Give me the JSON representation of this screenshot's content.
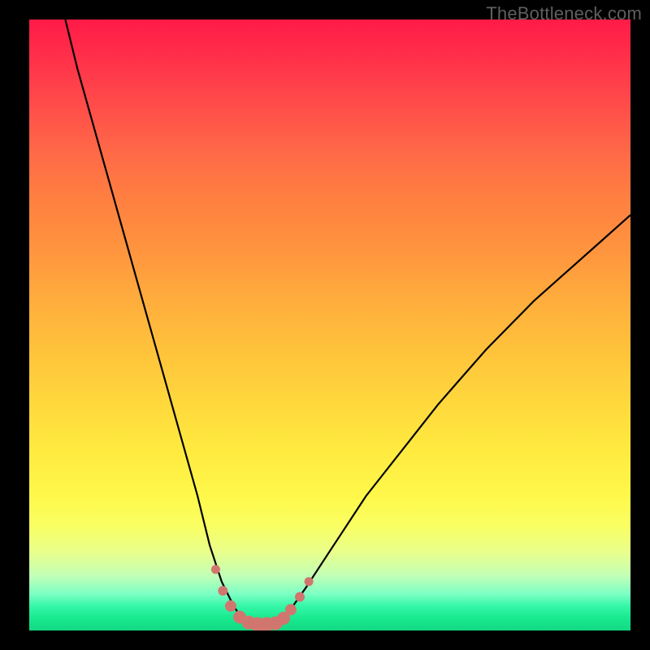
{
  "watermark": "TheBottleneck.com",
  "colors": {
    "frame": "#000000",
    "curve": "#000000",
    "marker_fill": "#d1766f",
    "marker_stroke": "#d1766f",
    "gradient_top": "#ff1b47",
    "gradient_bottom": "#13da83"
  },
  "chart_data": {
    "type": "line",
    "title": "",
    "xlabel": "",
    "ylabel": "",
    "xlim": [
      0,
      100
    ],
    "ylim": [
      0,
      100
    ],
    "annotations": [],
    "series": [
      {
        "name": "bottleneck-curve",
        "x": [
          6,
          8,
          10,
          12,
          14,
          16,
          18,
          20,
          22,
          24,
          26,
          28,
          30,
          31,
          32,
          33,
          34,
          35,
          36,
          37,
          38,
          39,
          40,
          41,
          42,
          43,
          44,
          46,
          48,
          50,
          52,
          56,
          60,
          64,
          68,
          72,
          76,
          80,
          84,
          88,
          92,
          96,
          100
        ],
        "y": [
          100,
          92,
          85,
          78,
          71,
          64,
          57,
          50,
          43,
          36,
          29,
          22,
          14,
          11,
          8,
          6,
          4,
          2.5,
          1.6,
          1.1,
          0.9,
          0.9,
          0.9,
          1.1,
          1.7,
          2.8,
          4.2,
          7,
          10,
          13,
          16,
          22,
          27,
          32,
          37,
          41.5,
          46,
          50,
          54,
          57.5,
          61,
          64.5,
          68
        ]
      }
    ],
    "markers": {
      "name": "highlight-points",
      "x": [
        31.0,
        32.2,
        33.5,
        35.0,
        36.5,
        38.0,
        39.5,
        41.0,
        42.3,
        43.5,
        45.0,
        46.5
      ],
      "y": [
        10.0,
        6.5,
        4.0,
        2.2,
        1.3,
        1.0,
        1.0,
        1.2,
        2.0,
        3.4,
        5.5,
        8.0
      ],
      "r": [
        5.5,
        6.0,
        7.0,
        8.0,
        8.5,
        9.0,
        9.0,
        8.5,
        8.0,
        7.0,
        6.0,
        5.5
      ]
    }
  }
}
